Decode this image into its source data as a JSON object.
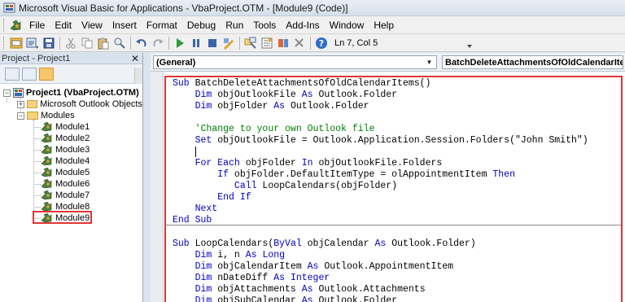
{
  "window": {
    "title": "Microsoft Visual Basic for Applications - VbaProject.OTM - [Module9 (Code)]"
  },
  "menubar": {
    "items": [
      {
        "label": "File"
      },
      {
        "label": "Edit"
      },
      {
        "label": "View"
      },
      {
        "label": "Insert"
      },
      {
        "label": "Format"
      },
      {
        "label": "Debug"
      },
      {
        "label": "Run"
      },
      {
        "label": "Tools"
      },
      {
        "label": "Add-Ins"
      },
      {
        "label": "Window"
      },
      {
        "label": "Help"
      }
    ]
  },
  "toolbar": {
    "cursor_position": "Ln 7, Col 5"
  },
  "project_explorer": {
    "title": "Project - Project1",
    "close_glyph": "✕",
    "root": "Project1 (VbaProject.OTM)",
    "outlook_objects": "Microsoft Outlook Objects",
    "modules_folder": "Modules",
    "modules": [
      "Module1",
      "Module2",
      "Module3",
      "Module4",
      "Module5",
      "Module6",
      "Module7",
      "Module8",
      "Module9"
    ],
    "selected": "Module9"
  },
  "code_window": {
    "object_combo": "(General)",
    "procedure_combo": "BatchDeleteAttachmentsOfOldCalendarItems",
    "lines": [
      [
        {
          "t": "Sub ",
          "c": "kw"
        },
        {
          "t": "BatchDeleteAttachmentsOfOldCalendarItems()",
          "c": "tx"
        }
      ],
      [
        {
          "t": "    Dim ",
          "c": "kw"
        },
        {
          "t": "objOutlookFile ",
          "c": "tx"
        },
        {
          "t": "As ",
          "c": "kw"
        },
        {
          "t": "Outlook.Folder",
          "c": "tx"
        }
      ],
      [
        {
          "t": "    Dim ",
          "c": "kw"
        },
        {
          "t": "objFolder ",
          "c": "tx"
        },
        {
          "t": "As ",
          "c": "kw"
        },
        {
          "t": "Outlook.Folder",
          "c": "tx"
        }
      ],
      [],
      [
        {
          "t": "    'Change to your own Outlook file",
          "c": "cm"
        }
      ],
      [
        {
          "t": "    Set ",
          "c": "kw"
        },
        {
          "t": "objOutlookFile = Outlook.Application.Session.Folders(\"John Smith\")",
          "c": "tx"
        }
      ],
      [
        {
          "t": "    ",
          "c": "tx"
        },
        {
          "t": "",
          "c": "caret"
        }
      ],
      [
        {
          "t": "    For Each ",
          "c": "kw"
        },
        {
          "t": "objFolder ",
          "c": "tx"
        },
        {
          "t": "In ",
          "c": "kw"
        },
        {
          "t": "objOutlookFile.Folders",
          "c": "tx"
        }
      ],
      [
        {
          "t": "        If ",
          "c": "kw"
        },
        {
          "t": "objFolder.DefaultItemType = olAppointmentItem ",
          "c": "tx"
        },
        {
          "t": "Then",
          "c": "kw"
        }
      ],
      [
        {
          "t": "           Call ",
          "c": "kw"
        },
        {
          "t": "LoopCalendars(objFolder)",
          "c": "tx"
        }
      ],
      [
        {
          "t": "        End If",
          "c": "kw"
        }
      ],
      [
        {
          "t": "    Next",
          "c": "kw"
        }
      ],
      [
        {
          "t": "End Sub",
          "c": "kw"
        }
      ],
      [],
      [
        {
          "t": "Sub ",
          "c": "kw"
        },
        {
          "t": "LoopCalendars(",
          "c": "tx"
        },
        {
          "t": "ByVal ",
          "c": "kw"
        },
        {
          "t": "objCalendar ",
          "c": "tx"
        },
        {
          "t": "As ",
          "c": "kw"
        },
        {
          "t": "Outlook.Folder)",
          "c": "tx"
        }
      ],
      [
        {
          "t": "    Dim ",
          "c": "kw"
        },
        {
          "t": "i, n ",
          "c": "tx"
        },
        {
          "t": "As Long",
          "c": "kw"
        }
      ],
      [
        {
          "t": "    Dim ",
          "c": "kw"
        },
        {
          "t": "objCalendarItem ",
          "c": "tx"
        },
        {
          "t": "As ",
          "c": "kw"
        },
        {
          "t": "Outlook.AppointmentItem",
          "c": "tx"
        }
      ],
      [
        {
          "t": "    Dim ",
          "c": "kw"
        },
        {
          "t": "nDateDiff ",
          "c": "tx"
        },
        {
          "t": "As Integer",
          "c": "kw"
        }
      ],
      [
        {
          "t": "    Dim ",
          "c": "kw"
        },
        {
          "t": "objAttachments ",
          "c": "tx"
        },
        {
          "t": "As ",
          "c": "kw"
        },
        {
          "t": "Outlook.Attachments",
          "c": "tx"
        }
      ],
      [
        {
          "t": "    Dim ",
          "c": "kw"
        },
        {
          "t": "objSubCalendar ",
          "c": "tx"
        },
        {
          "t": "As ",
          "c": "kw"
        },
        {
          "t": "Outlook.Folder",
          "c": "tx"
        }
      ]
    ]
  },
  "colors": {
    "keyword": "#0000c0",
    "comment": "#008000",
    "highlight_box": "#e03535"
  }
}
